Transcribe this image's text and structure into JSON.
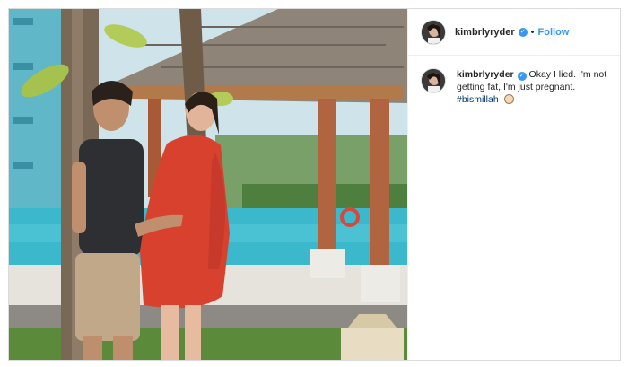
{
  "post": {
    "username": "kimbrlyryder",
    "follow_label": "Follow",
    "separator": "•",
    "verified_icon": "verified-badge-icon",
    "photo_alt": "couple posing by pool under gazebo"
  },
  "caption": {
    "username": "kimbrlyryder",
    "text": "Okay I lied. I'm not getting fat, I'm just pregnant.",
    "hashtag": "#bismillah",
    "emoji": "baby-face-emoji-icon"
  },
  "colors": {
    "link_blue": "#3897f0",
    "hashtag": "#003569",
    "text": "#262626",
    "border": "#dbdbdb"
  }
}
